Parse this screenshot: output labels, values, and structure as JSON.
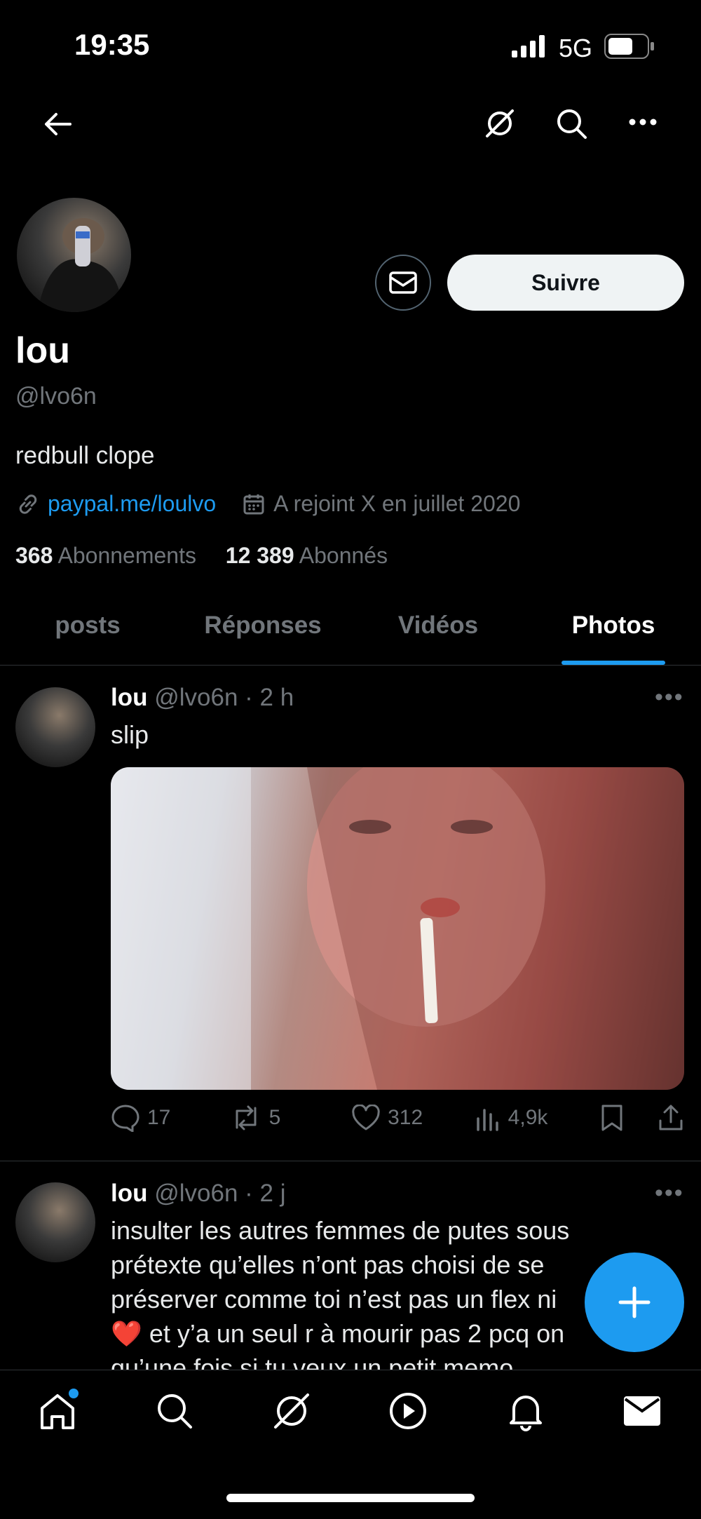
{
  "status_bar": {
    "time": "19:35",
    "network": "5G"
  },
  "header": {
    "icons": [
      "back-arrow-icon",
      "grok-icon",
      "search-icon",
      "more-icon"
    ]
  },
  "profile": {
    "name": "lou",
    "handle": "@lvo6n",
    "bio": "redbull clope",
    "link": "paypal.me/loulvo",
    "joined": "A rejoint X en juillet 2020",
    "following_count": "368",
    "following_label": "Abonnements",
    "followers_count": "12 389",
    "followers_label": "Abonnés",
    "follow_label": "Suivre"
  },
  "tabs": [
    {
      "label": "posts",
      "active": false
    },
    {
      "label": "Réponses",
      "active": false
    },
    {
      "label": "Vidéos",
      "active": false
    },
    {
      "label": "Photos",
      "active": true
    }
  ],
  "posts": [
    {
      "name": "lou",
      "handle": "@lvo6n",
      "time": "2 h",
      "text": "slip",
      "replies": "17",
      "reposts": "5",
      "likes": "312",
      "views": "4,9k"
    },
    {
      "name": "lou",
      "handle": "@lvo6n",
      "time": "2 j",
      "text_lines": [
        "insulter les autres femmes de putes sous",
        "prétexte qu’elles n’ont pas choisi de se",
        "préserver comme toi n’est pas un flex ni",
        "❤️ et y’a un seul r à mourir pas 2 pcq on",
        "qu’une fois si tu veux un petit memo"
      ]
    }
  ],
  "bottom_nav": [
    "home-icon",
    "search-icon",
    "grok-icon",
    "video-icon",
    "notifications-icon",
    "messages-icon"
  ]
}
